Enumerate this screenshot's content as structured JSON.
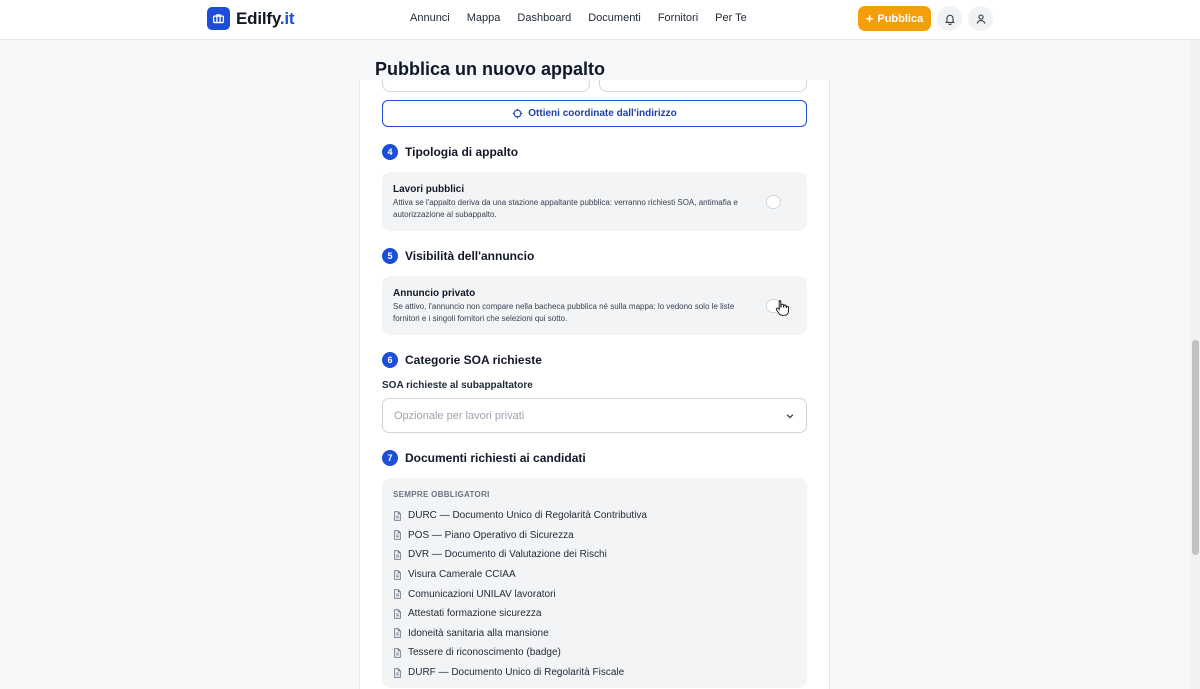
{
  "header": {
    "logo_text": "Edilfy",
    "logo_tld": ".it",
    "nav": [
      "Annunci",
      "Mappa",
      "Dashboard",
      "Documenti",
      "Fornitori",
      "Per Te"
    ],
    "publish_label": "Pubblica",
    "accent": "#1d4ed8",
    "publish_color": "#f59e0b"
  },
  "page": {
    "title": "Pubblica un nuovo appalto",
    "coords_button": "Ottieni coordinate dall'indirizzo"
  },
  "sections": {
    "tipologia": {
      "num": "4",
      "title": "Tipologia di appalto",
      "toggle_title": "Lavori pubblici",
      "toggle_desc": "Attiva se l'appalto deriva da una stazione appaltante pubblica: verranno richiesti SOA, antimafia e autorizzazione al subappalto.",
      "enabled": false
    },
    "visibilita": {
      "num": "5",
      "title": "Visibilità dell'annuncio",
      "toggle_title": "Annuncio privato",
      "toggle_desc": "Se attivo, l'annuncio non compare nella bacheca pubblica né sulla mappa: lo vedono solo le liste fornitori e i singoli fornitori che selezioni qui sotto.",
      "enabled": false
    },
    "soa": {
      "num": "6",
      "title": "Categorie SOA richieste",
      "field_label": "SOA richieste al subappaltatore",
      "placeholder": "Opzionale per lavori privati"
    },
    "documenti": {
      "num": "7",
      "title": "Documenti richiesti ai candidati",
      "group_heading": "SEMPRE OBBLIGATORI",
      "items": [
        "DURC — Documento Unico di Regolarità Contributiva",
        "POS — Piano Operativo di Sicurezza",
        "DVR — Documento di Valutazione dei Rischi",
        "Visura Camerale CCIAA",
        "Comunicazioni UNILAV lavoratori",
        "Attestati formazione sicurezza",
        "Idoneità sanitaria alla mansione",
        "Tessere di riconoscimento (badge)",
        "DURF — Documento Unico di Regolarità Fiscale"
      ]
    }
  }
}
